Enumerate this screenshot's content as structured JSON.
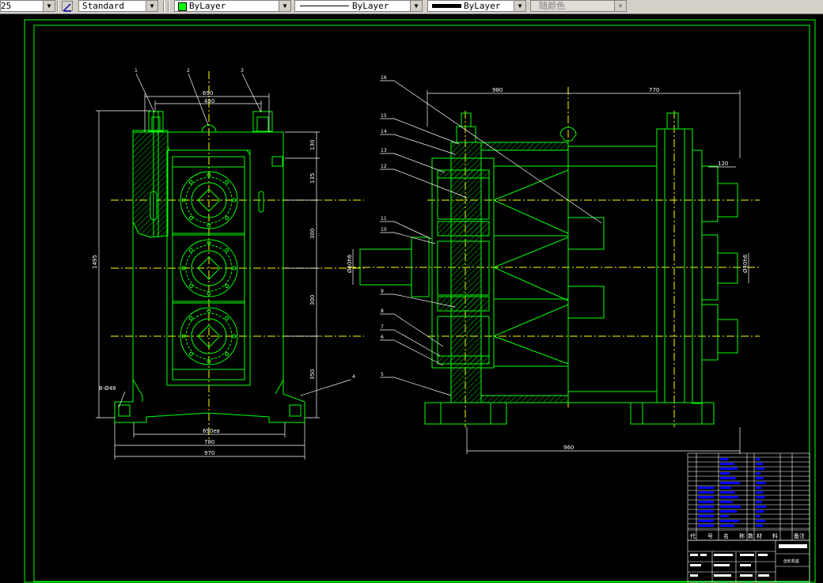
{
  "toolbar": {
    "dimscale": "25",
    "dimstyle": "Standard",
    "color": "ByLayer",
    "linetype": "ByLayer",
    "lineweight": "ByLayer",
    "plotstyle": "随颜色",
    "color_swatch": "#00ff00"
  },
  "drawing": {
    "colors": {
      "outline": "#00ff00",
      "center": "#ffff00",
      "dim": "#ffffff",
      "leader": "#ffffff",
      "hatch": "#00ff00"
    },
    "front_dims": {
      "top_outer": "690",
      "top_inner": "450",
      "height_total": "1495",
      "h1": "130",
      "h2": "135",
      "h3": "300",
      "h4": "300",
      "h5": "350",
      "bottom_inner": "690ев",
      "bottom_mid": "780",
      "bottom_outer": "970",
      "holes": "8-Ø48"
    },
    "front_balloons": [
      "1",
      "2",
      "3",
      "4"
    ],
    "side_dims": {
      "left_width": "980",
      "right_width": "770",
      "flange_width": "120",
      "bottom_width": "960",
      "shaft_dia": "Ø50h6",
      "out_dia": "Ø40h6"
    },
    "side_balloons": [
      "16",
      "15",
      "14",
      "13",
      "12",
      "11",
      "10",
      "9",
      "8",
      "7",
      "6",
      "5"
    ],
    "title_block": {
      "headers": [
        "代",
        "号",
        "名",
        "称",
        "数",
        "材",
        "料",
        "备注"
      ],
      "drawing_name": "齿轮机座"
    }
  }
}
